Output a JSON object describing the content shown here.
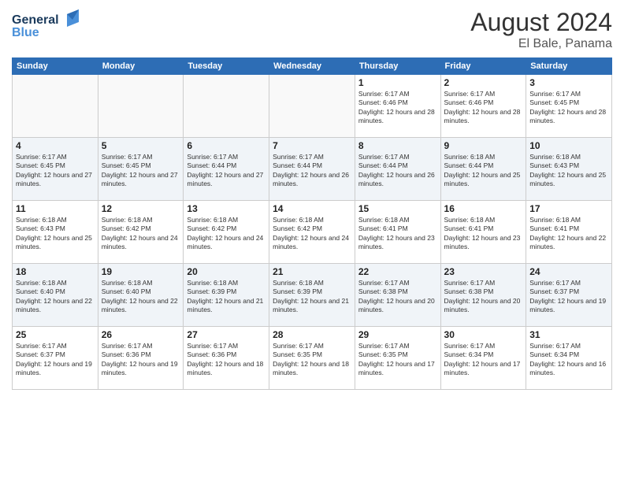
{
  "header": {
    "logo_line1": "General",
    "logo_line2": "Blue",
    "month_title": "August 2024",
    "location": "El Bale, Panama"
  },
  "weekdays": [
    "Sunday",
    "Monday",
    "Tuesday",
    "Wednesday",
    "Thursday",
    "Friday",
    "Saturday"
  ],
  "weeks": [
    [
      {
        "day": "",
        "sunrise": "",
        "sunset": "",
        "daylight": ""
      },
      {
        "day": "",
        "sunrise": "",
        "sunset": "",
        "daylight": ""
      },
      {
        "day": "",
        "sunrise": "",
        "sunset": "",
        "daylight": ""
      },
      {
        "day": "",
        "sunrise": "",
        "sunset": "",
        "daylight": ""
      },
      {
        "day": "1",
        "sunrise": "Sunrise: 6:17 AM",
        "sunset": "Sunset: 6:46 PM",
        "daylight": "Daylight: 12 hours and 28 minutes."
      },
      {
        "day": "2",
        "sunrise": "Sunrise: 6:17 AM",
        "sunset": "Sunset: 6:46 PM",
        "daylight": "Daylight: 12 hours and 28 minutes."
      },
      {
        "day": "3",
        "sunrise": "Sunrise: 6:17 AM",
        "sunset": "Sunset: 6:45 PM",
        "daylight": "Daylight: 12 hours and 28 minutes."
      }
    ],
    [
      {
        "day": "4",
        "sunrise": "Sunrise: 6:17 AM",
        "sunset": "Sunset: 6:45 PM",
        "daylight": "Daylight: 12 hours and 27 minutes."
      },
      {
        "day": "5",
        "sunrise": "Sunrise: 6:17 AM",
        "sunset": "Sunset: 6:45 PM",
        "daylight": "Daylight: 12 hours and 27 minutes."
      },
      {
        "day": "6",
        "sunrise": "Sunrise: 6:17 AM",
        "sunset": "Sunset: 6:44 PM",
        "daylight": "Daylight: 12 hours and 27 minutes."
      },
      {
        "day": "7",
        "sunrise": "Sunrise: 6:17 AM",
        "sunset": "Sunset: 6:44 PM",
        "daylight": "Daylight: 12 hours and 26 minutes."
      },
      {
        "day": "8",
        "sunrise": "Sunrise: 6:17 AM",
        "sunset": "Sunset: 6:44 PM",
        "daylight": "Daylight: 12 hours and 26 minutes."
      },
      {
        "day": "9",
        "sunrise": "Sunrise: 6:18 AM",
        "sunset": "Sunset: 6:44 PM",
        "daylight": "Daylight: 12 hours and 25 minutes."
      },
      {
        "day": "10",
        "sunrise": "Sunrise: 6:18 AM",
        "sunset": "Sunset: 6:43 PM",
        "daylight": "Daylight: 12 hours and 25 minutes."
      }
    ],
    [
      {
        "day": "11",
        "sunrise": "Sunrise: 6:18 AM",
        "sunset": "Sunset: 6:43 PM",
        "daylight": "Daylight: 12 hours and 25 minutes."
      },
      {
        "day": "12",
        "sunrise": "Sunrise: 6:18 AM",
        "sunset": "Sunset: 6:42 PM",
        "daylight": "Daylight: 12 hours and 24 minutes."
      },
      {
        "day": "13",
        "sunrise": "Sunrise: 6:18 AM",
        "sunset": "Sunset: 6:42 PM",
        "daylight": "Daylight: 12 hours and 24 minutes."
      },
      {
        "day": "14",
        "sunrise": "Sunrise: 6:18 AM",
        "sunset": "Sunset: 6:42 PM",
        "daylight": "Daylight: 12 hours and 24 minutes."
      },
      {
        "day": "15",
        "sunrise": "Sunrise: 6:18 AM",
        "sunset": "Sunset: 6:41 PM",
        "daylight": "Daylight: 12 hours and 23 minutes."
      },
      {
        "day": "16",
        "sunrise": "Sunrise: 6:18 AM",
        "sunset": "Sunset: 6:41 PM",
        "daylight": "Daylight: 12 hours and 23 minutes."
      },
      {
        "day": "17",
        "sunrise": "Sunrise: 6:18 AM",
        "sunset": "Sunset: 6:41 PM",
        "daylight": "Daylight: 12 hours and 22 minutes."
      }
    ],
    [
      {
        "day": "18",
        "sunrise": "Sunrise: 6:18 AM",
        "sunset": "Sunset: 6:40 PM",
        "daylight": "Daylight: 12 hours and 22 minutes."
      },
      {
        "day": "19",
        "sunrise": "Sunrise: 6:18 AM",
        "sunset": "Sunset: 6:40 PM",
        "daylight": "Daylight: 12 hours and 22 minutes."
      },
      {
        "day": "20",
        "sunrise": "Sunrise: 6:18 AM",
        "sunset": "Sunset: 6:39 PM",
        "daylight": "Daylight: 12 hours and 21 minutes."
      },
      {
        "day": "21",
        "sunrise": "Sunrise: 6:18 AM",
        "sunset": "Sunset: 6:39 PM",
        "daylight": "Daylight: 12 hours and 21 minutes."
      },
      {
        "day": "22",
        "sunrise": "Sunrise: 6:17 AM",
        "sunset": "Sunset: 6:38 PM",
        "daylight": "Daylight: 12 hours and 20 minutes."
      },
      {
        "day": "23",
        "sunrise": "Sunrise: 6:17 AM",
        "sunset": "Sunset: 6:38 PM",
        "daylight": "Daylight: 12 hours and 20 minutes."
      },
      {
        "day": "24",
        "sunrise": "Sunrise: 6:17 AM",
        "sunset": "Sunset: 6:37 PM",
        "daylight": "Daylight: 12 hours and 19 minutes."
      }
    ],
    [
      {
        "day": "25",
        "sunrise": "Sunrise: 6:17 AM",
        "sunset": "Sunset: 6:37 PM",
        "daylight": "Daylight: 12 hours and 19 minutes."
      },
      {
        "day": "26",
        "sunrise": "Sunrise: 6:17 AM",
        "sunset": "Sunset: 6:36 PM",
        "daylight": "Daylight: 12 hours and 19 minutes."
      },
      {
        "day": "27",
        "sunrise": "Sunrise: 6:17 AM",
        "sunset": "Sunset: 6:36 PM",
        "daylight": "Daylight: 12 hours and 18 minutes."
      },
      {
        "day": "28",
        "sunrise": "Sunrise: 6:17 AM",
        "sunset": "Sunset: 6:35 PM",
        "daylight": "Daylight: 12 hours and 18 minutes."
      },
      {
        "day": "29",
        "sunrise": "Sunrise: 6:17 AM",
        "sunset": "Sunset: 6:35 PM",
        "daylight": "Daylight: 12 hours and 17 minutes."
      },
      {
        "day": "30",
        "sunrise": "Sunrise: 6:17 AM",
        "sunset": "Sunset: 6:34 PM",
        "daylight": "Daylight: 12 hours and 17 minutes."
      },
      {
        "day": "31",
        "sunrise": "Sunrise: 6:17 AM",
        "sunset": "Sunset: 6:34 PM",
        "daylight": "Daylight: 12 hours and 16 minutes."
      }
    ]
  ]
}
